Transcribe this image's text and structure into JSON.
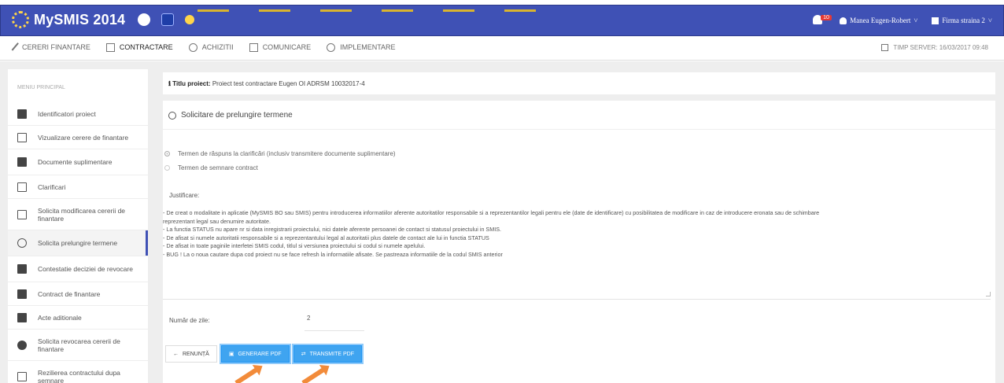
{
  "app": {
    "title": "MySMIS 2014",
    "notifications_badge": "10",
    "user_name": "Manea Eugen-Robert",
    "firm_name": "Firma straina 2",
    "accent_color": "#3f51b5"
  },
  "nav": {
    "items": [
      {
        "label": "CERERI FINANTARE",
        "icon": "pencil-icon"
      },
      {
        "label": "CONTRACTARE",
        "icon": "document-icon"
      },
      {
        "label": "ACHIZITII",
        "icon": "layers-icon"
      },
      {
        "label": "COMUNICARE",
        "icon": "monitor-icon"
      },
      {
        "label": "IMPLEMENTARE",
        "icon": "layers-icon"
      }
    ],
    "server_time": "TIMP SERVER: 16/03/2017 09:48"
  },
  "sidebar": {
    "title": "MENIU PRINCIPAL",
    "items": [
      {
        "label": "Identificatori proiect"
      },
      {
        "label": "Vizualizare cerere de finantare"
      },
      {
        "label": "Documente suplimentare"
      },
      {
        "label": "Clarificari"
      },
      {
        "label": "Solicita modificarea cererii de finantare"
      },
      {
        "label": "Solicita prelungire termene"
      },
      {
        "label": "Contestatie deciziei de revocare"
      },
      {
        "label": "Contract de finantare"
      },
      {
        "label": "Acte aditionale"
      },
      {
        "label": "Solicita revocarea cererii de finantare"
      },
      {
        "label": "Rezilierea contractului dupa semnare"
      }
    ]
  },
  "project": {
    "title_label": "Titlu proiect:",
    "title_value": "Proiect test contractare Eugen OI ADRSM 10032017-4"
  },
  "form": {
    "section_title": "Solicitare de prelungire termene",
    "options": [
      {
        "label": "Termen de răspuns la clarificări (inclusiv transmitere documente suplimentare)",
        "checked": true
      },
      {
        "label": "Termen de semnare contract",
        "checked": false
      }
    ],
    "justification_label": "Justificare:",
    "justification_lines": [
      "-    De creat o modalitate in aplicatie (MySMIS BO sau SMIS) pentru introducerea informatiilor aferente autoritatilor responsabile si a reprezentantilor legali pentru ele (date de identificare) cu posibilitatea de modificare in caz de introducere eronata sau de schimbare",
      "reprezentant legal sau denumire autoritate.",
      "-       La functia STATUS nu apare nr si data inregistrarii proiectului, nici datele aferente persoanei de contact si statusul proiectului in SMIS.",
      "-       De afisat si numele autoritatii responsabile si a reprezentantului legal al autoritatii plus datele de contact ale lui in functia STATUS",
      "-       De afisat in toate paginile interfetei SMIS codul, titlul si versiunea proiectului si codul si numele apelului.",
      "-       BUG ! La o noua cautare dupa cod proiect nu se face refresh la informatiile afisate. Se pastreaza informatiile de la codul SMIS anterior"
    ],
    "days_label": "Număr de zile:",
    "days_value": "2",
    "buttons": {
      "cancel": "RENUNȚĂ",
      "generate": "GENERARE PDF",
      "transmit": "TRANSMITE PDF"
    }
  }
}
